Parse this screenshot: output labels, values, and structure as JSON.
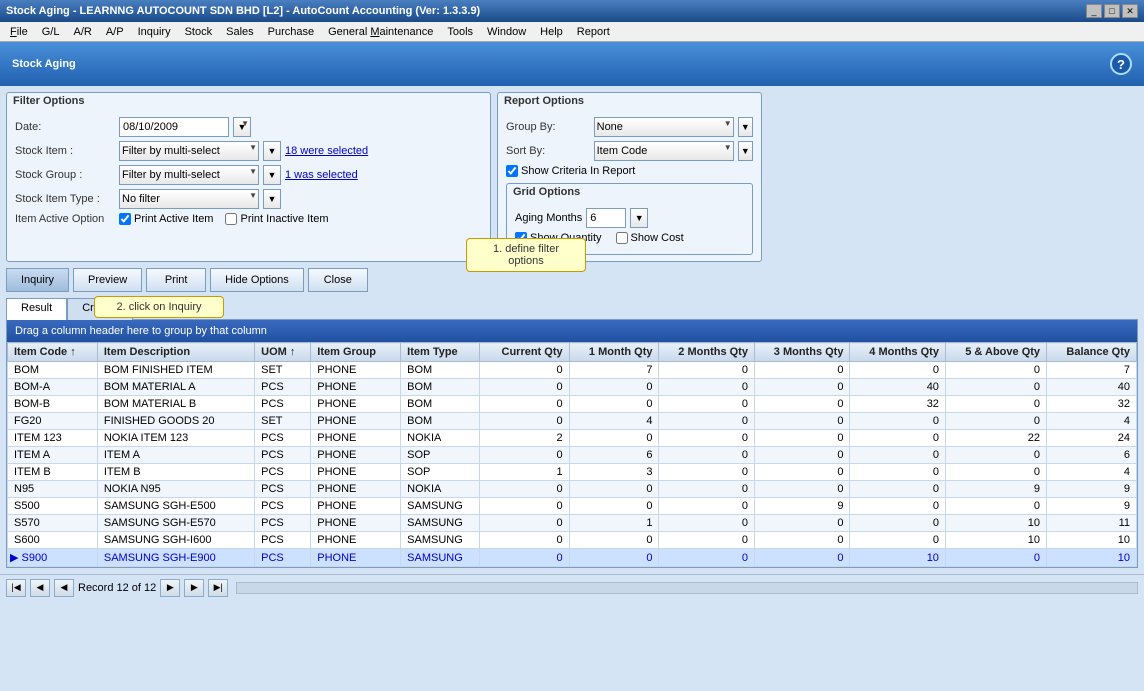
{
  "window": {
    "title": "Stock Aging - LEARNNG AUTOCOUNT SDN BHD [L2] - AutoCount Accounting (Ver: 1.3.3.9)"
  },
  "menu": {
    "items": [
      "File",
      "G/L",
      "A/R",
      "A/P",
      "Inquiry",
      "Stock",
      "Sales",
      "Purchase",
      "General Maintenance",
      "Tools",
      "Window",
      "Help",
      "Report"
    ]
  },
  "page_title": "Stock Aging",
  "help_label": "?",
  "filter_options": {
    "title": "Filter Options",
    "date_label": "Date:",
    "date_value": "08/10/2009",
    "stock_item_label": "Stock Item :",
    "stock_item_value": "Filter by multi-select",
    "stock_item_link": "18 were selected",
    "stock_group_label": "Stock Group :",
    "stock_group_value": "Filter by multi-select",
    "stock_group_link": "1 was selected",
    "stock_item_type_label": "Stock Item Type :",
    "stock_item_type_value": "No filter",
    "item_active_label": "Item Active Option",
    "print_active": "Print Active Item",
    "print_inactive": "Print Inactive Item"
  },
  "report_options": {
    "title": "Report Options",
    "group_by_label": "Group By:",
    "group_by_value": "None",
    "sort_by_label": "Sort By:",
    "sort_by_value": "Item Code",
    "show_criteria": "Show Criteria In Report"
  },
  "grid_options": {
    "title": "Grid Options",
    "aging_months_label": "Aging Months",
    "aging_months_value": "6",
    "show_quantity": "Show Quantity",
    "show_cost": "Show Cost"
  },
  "buttons": {
    "inquiry": "Inquiry",
    "preview": "Preview",
    "print": "Print",
    "hide_options": "Hide Options",
    "close": "Close"
  },
  "callouts": {
    "step1": "1. define filter options",
    "step2": "2. click on Inquiry"
  },
  "tabs": {
    "result": "Result",
    "criteria": "Criteria"
  },
  "drag_hint": "Drag a column header here to group by that column",
  "table": {
    "columns": [
      "Item Code ↑",
      "Item Description",
      "UOM ↑",
      "Item Group",
      "Item Type",
      "Current Qty",
      "1 Month Qty",
      "2 Months Qty",
      "3 Months Qty",
      "4 Months Qty",
      "5 & Above Qty",
      "Balance Qty"
    ],
    "rows": [
      {
        "code": "BOM",
        "desc": "BOM FINISHED ITEM",
        "uom": "SET",
        "group": "PHONE",
        "type": "BOM",
        "curr": 0,
        "m1": 7,
        "m2": 0,
        "m3": 0,
        "m4": 0,
        "m5": 0,
        "bal": 7
      },
      {
        "code": "BOM-A",
        "desc": "BOM MATERIAL A",
        "uom": "PCS",
        "group": "PHONE",
        "type": "BOM",
        "curr": 0,
        "m1": 0,
        "m2": 0,
        "m3": 0,
        "m4": 40,
        "m5": 0,
        "bal": 40
      },
      {
        "code": "BOM-B",
        "desc": "BOM MATERIAL B",
        "uom": "PCS",
        "group": "PHONE",
        "type": "BOM",
        "curr": 0,
        "m1": 0,
        "m2": 0,
        "m3": 0,
        "m4": 32,
        "m5": 0,
        "bal": 32
      },
      {
        "code": "FG20",
        "desc": "FINISHED GOODS 20",
        "uom": "SET",
        "group": "PHONE",
        "type": "BOM",
        "curr": 0,
        "m1": 4,
        "m2": 0,
        "m3": 0,
        "m4": 0,
        "m5": 0,
        "bal": 4
      },
      {
        "code": "ITEM 123",
        "desc": "NOKIA ITEM 123",
        "uom": "PCS",
        "group": "PHONE",
        "type": "NOKIA",
        "curr": 2,
        "m1": 0,
        "m2": 0,
        "m3": 0,
        "m4": 0,
        "m5": 22,
        "bal": 24
      },
      {
        "code": "ITEM A",
        "desc": "ITEM A",
        "uom": "PCS",
        "group": "PHONE",
        "type": "SOP",
        "curr": 0,
        "m1": 6,
        "m2": 0,
        "m3": 0,
        "m4": 0,
        "m5": 0,
        "bal": 6
      },
      {
        "code": "ITEM B",
        "desc": "ITEM B",
        "uom": "PCS",
        "group": "PHONE",
        "type": "SOP",
        "curr": 1,
        "m1": 3,
        "m2": 0,
        "m3": 0,
        "m4": 0,
        "m5": 0,
        "bal": 4
      },
      {
        "code": "N95",
        "desc": "NOKIA N95",
        "uom": "PCS",
        "group": "PHONE",
        "type": "NOKIA",
        "curr": 0,
        "m1": 0,
        "m2": 0,
        "m3": 0,
        "m4": 0,
        "m5": 9,
        "bal": 9
      },
      {
        "code": "S500",
        "desc": "SAMSUNG SGH-E500",
        "uom": "PCS",
        "group": "PHONE",
        "type": "SAMSUNG",
        "curr": 0,
        "m1": 0,
        "m2": 0,
        "m3": 9,
        "m4": 0,
        "m5": 0,
        "bal": 9
      },
      {
        "code": "S570",
        "desc": "SAMSUNG SGH-E570",
        "uom": "PCS",
        "group": "PHONE",
        "type": "SAMSUNG",
        "curr": 0,
        "m1": 1,
        "m2": 0,
        "m3": 0,
        "m4": 0,
        "m5": 10,
        "bal": 11
      },
      {
        "code": "S600",
        "desc": "SAMSUNG SGH-I600",
        "uom": "PCS",
        "group": "PHONE",
        "type": "SAMSUNG",
        "curr": 0,
        "m1": 0,
        "m2": 0,
        "m3": 0,
        "m4": 0,
        "m5": 10,
        "bal": 10
      },
      {
        "code": "S900",
        "desc": "SAMSUNG SGH-E900",
        "uom": "PCS",
        "group": "PHONE",
        "type": "SAMSUNG",
        "curr": 0,
        "m1": 0,
        "m2": 0,
        "m3": 0,
        "m4": 10,
        "m5": 0,
        "bal": 10,
        "selected": true
      }
    ]
  },
  "status": {
    "record_text": "Record 12 of 12"
  }
}
